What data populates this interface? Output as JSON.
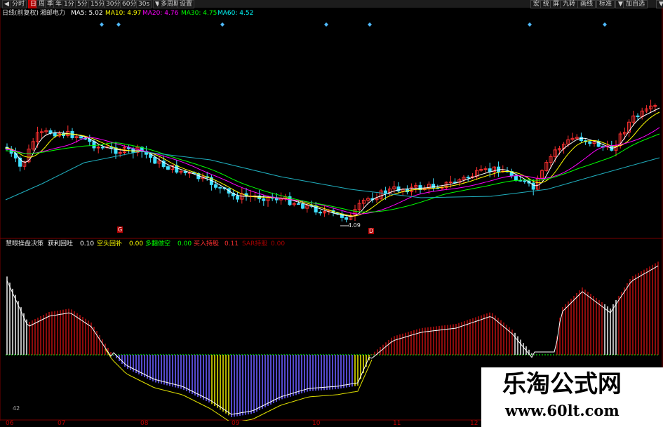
{
  "toolbar": {
    "left_buttons": [
      {
        "label": "◀",
        "active": false
      },
      {
        "label": "分时",
        "active": false
      },
      {
        "label": "日",
        "active": true
      },
      {
        "label": "周",
        "active": false
      },
      {
        "label": "季",
        "active": false
      },
      {
        "label": "年",
        "active": false
      },
      {
        "label": "1分",
        "active": false
      },
      {
        "label": "5分",
        "active": false
      },
      {
        "label": "15分",
        "active": false
      },
      {
        "label": "30分",
        "active": false
      },
      {
        "label": "60分",
        "active": false
      },
      {
        "label": "30s",
        "active": false
      },
      {
        "label": "▼",
        "active": false
      },
      {
        "label": "多周期",
        "active": false
      },
      {
        "label": "设置",
        "active": false
      }
    ],
    "right_buttons": [
      {
        "label": "宏"
      },
      {
        "label": "统"
      },
      {
        "label": "屏"
      },
      {
        "label": "九转"
      },
      {
        "label": "画线"
      },
      {
        "label": "标准"
      },
      {
        "label": "▼"
      },
      {
        "label": "加自选"
      },
      {
        "label": "▼"
      }
    ]
  },
  "main_header": {
    "period": "日线(前复权)",
    "stock_name": "湘邮电力",
    "ma": [
      {
        "label": "MA5: 5.02",
        "color": "#ffffff"
      },
      {
        "label": "MA10: 4.97",
        "color": "#ffff00"
      },
      {
        "label": "MA20: 4.76",
        "color": "#ff00ff"
      },
      {
        "label": "MA30: 4.75",
        "color": "#00ff00"
      },
      {
        "label": "MA60: 4.52",
        "color": "#00ffff"
      }
    ]
  },
  "price_labels": {
    "low_marker": "4.09",
    "signal_left": "G",
    "signal_right": "D"
  },
  "indicator_header": {
    "title": "慧眼操盘决策",
    "items": [
      {
        "label": "获利回吐",
        "value": "0.10",
        "color": "#ffffff"
      },
      {
        "label": "空头回补",
        "value": "0.00",
        "color": "#ffff00"
      },
      {
        "label": "多翻做空",
        "value": "0.00",
        "color": "#00ff00"
      },
      {
        "label": "买入持股",
        "value": "0.11",
        "color": "#ff3030"
      },
      {
        "label": "SAR持股",
        "value": "0.00",
        "color": "#aa0000"
      }
    ]
  },
  "indicator_value_label": "42",
  "x_axis": [
    "06",
    "07",
    "08",
    "09",
    "10",
    "11",
    "12"
  ],
  "watermark": {
    "line1": "乐淘公式网",
    "line2": "www.60lt.com"
  },
  "colors": {
    "up": "#ff3030",
    "down": "#40e0ff",
    "positive_bar": "#b01010",
    "negative_bar": "#6a5cff",
    "zero_line": "#00c000"
  }
}
